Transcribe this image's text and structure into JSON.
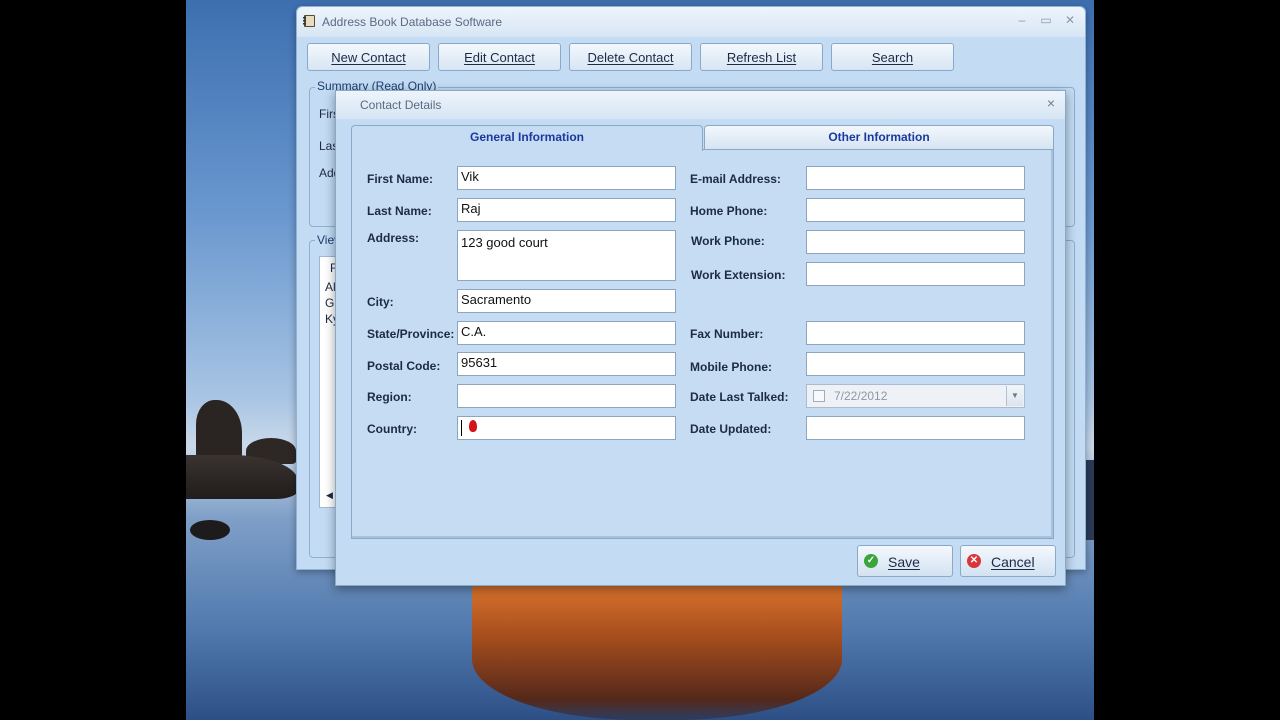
{
  "colors": {
    "accent_tab_text": "#1a3aa0",
    "save_icon": "#3aa53a",
    "cancel_icon": "#d9353a"
  },
  "main_window": {
    "title": "Address Book Database Software",
    "toolbar": {
      "new_contact": "New Contact",
      "edit_contact": "Edit Contact",
      "delete_contact": "Delete Contact",
      "refresh_list": "Refresh List",
      "search": "Search"
    },
    "summary_group": "Summary (Read Only)",
    "summary_labels": [
      "First",
      "Las",
      "Add"
    ],
    "view_group": "Viev",
    "list_items": [
      "F",
      "Al",
      "Gi",
      "Ky"
    ]
  },
  "dialog": {
    "title": "Contact Details",
    "close": "×",
    "tabs": {
      "general": "General Information",
      "other": "Other Information"
    },
    "left_fields": {
      "first_name_label": "First Name:",
      "first_name_value": "Vik",
      "last_name_label": "Last Name:",
      "last_name_value": "Raj",
      "address_label": "Address:",
      "address_value": "123 good court",
      "city_label": "City:",
      "city_value": "Sacramento",
      "state_label": "State/Province:",
      "state_value": "C.A.",
      "postal_label": "Postal Code:",
      "postal_value": "95631",
      "region_label": "Region:",
      "region_value": "",
      "country_label": "Country:",
      "country_value": ""
    },
    "right_fields": {
      "email_label": "E-mail Address:",
      "email_value": "",
      "home_phone_label": "Home Phone:",
      "home_phone_value": "",
      "work_phone_label": "Work Phone:",
      "work_phone_value": "",
      "work_ext_label": "Work Extension:",
      "work_ext_value": "",
      "fax_label": "Fax Number:",
      "fax_value": "",
      "mobile_label": "Mobile Phone:",
      "mobile_value": "",
      "date_last_talked_label": "Date Last Talked:",
      "date_last_talked_value": "7/22/2012",
      "date_updated_label": "Date Updated:",
      "date_updated_value": ""
    },
    "buttons": {
      "save": "Save",
      "cancel": "Cancel"
    }
  }
}
